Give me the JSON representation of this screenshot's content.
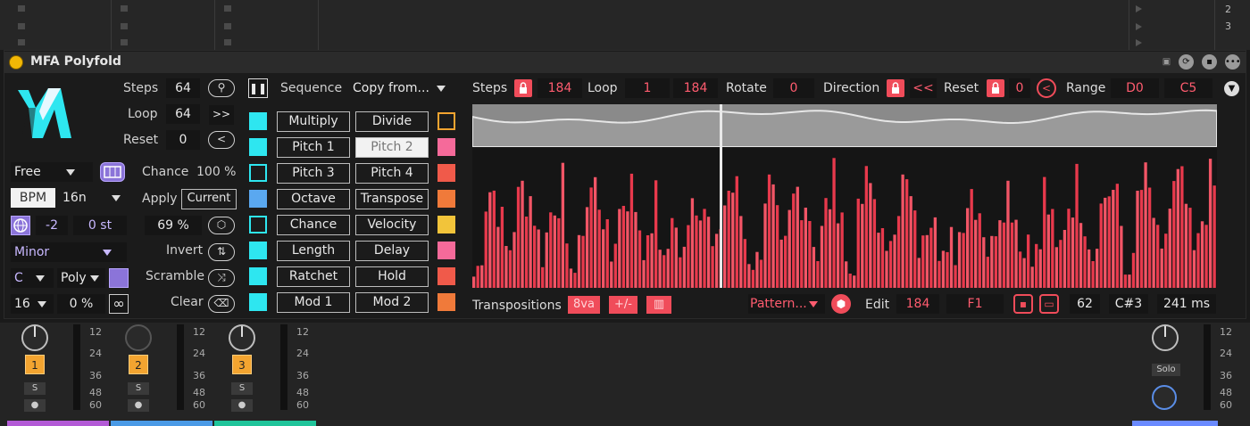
{
  "device": {
    "title": "MFA Polyfold"
  },
  "top": {
    "scenes": [
      "2",
      "3"
    ]
  },
  "left": {
    "steps_label": "Steps",
    "steps_value": "64",
    "loop_label": "Loop",
    "loop_value": "64",
    "loop_btn": ">>",
    "reset_label": "Reset",
    "reset_value": "0",
    "reset_btn": "<",
    "sync_mode": "Free",
    "time_mode": "BPM",
    "rate": "16n",
    "transpose_oct": "-2",
    "transpose_semi": "0 st",
    "scale": "Minor",
    "root": "C",
    "voice_mode": "Poly",
    "count": "16",
    "percent": "0 %",
    "infinity": "∞"
  },
  "middle": {
    "chance_label": "Chance",
    "chance_value": "100 %",
    "apply_label": "Apply",
    "apply_btn": "Current",
    "random_value": "69 %",
    "invert_label": "Invert",
    "scramble_label": "Scramble",
    "clear_label": "Clear",
    "sequence_label": "Sequence",
    "copy_from": "Copy from..."
  },
  "modes": {
    "left": [
      "Multiply",
      "Pitch 1",
      "Pitch 3",
      "Octave",
      "Chance",
      "Length",
      "Ratchet",
      "Mod 1"
    ],
    "right": [
      "Divide",
      "Pitch 2",
      "Pitch 4",
      "Transpose",
      "Velocity",
      "Delay",
      "Hold",
      "Mod 2"
    ],
    "selected": "Pitch 2"
  },
  "seq": {
    "steps_label": "Steps",
    "steps_value": "184",
    "loop_label": "Loop",
    "loop_start": "1",
    "loop_end": "184",
    "rotate_label": "Rotate",
    "rotate_value": "0",
    "direction_label": "Direction",
    "direction_value": "<<",
    "reset_label": "Reset",
    "reset_value": "0",
    "reset_btn": "<",
    "range_label": "Range",
    "range_low": "D0",
    "range_high": "C5",
    "transpositions_label": "Transpositions",
    "trans_8va": "8va",
    "trans_pm": "+/-",
    "pattern": "Pattern...",
    "edit_label": "Edit",
    "edit_step": "184",
    "edit_note": "F1",
    "status_step": "62",
    "status_note": "C#3",
    "status_time": "241 ms"
  },
  "mixer": {
    "tracks": [
      "1",
      "2",
      "3"
    ],
    "solo": "S",
    "master_solo": "Solo",
    "scale": [
      "12",
      "24",
      "36",
      "48",
      "60"
    ]
  },
  "colors": {
    "accent": "#f04c5a",
    "cyan": "#2ee6f0",
    "orange": "#f3a430",
    "purple": "#8b74d9"
  }
}
